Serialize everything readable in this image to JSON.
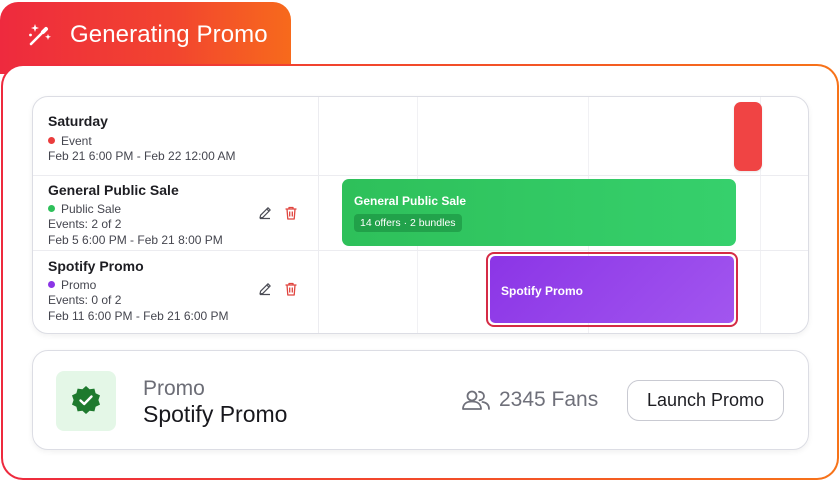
{
  "header": {
    "title": "Generating Promo",
    "icon": "magic-wand-icon"
  },
  "colors": {
    "accent_start": "#ee2a3e",
    "accent_end": "#f77319",
    "event": "#f04444",
    "public_sale": "#2ec05a",
    "promo": "#8b35e6",
    "verified": "#1e7a2e"
  },
  "schedule": {
    "rows": [
      {
        "title": "Saturday",
        "type": "Event",
        "dates": "Feb 21 6:00 PM - Feb 22 12:00 AM"
      },
      {
        "title": "General Public Sale",
        "type": "Public Sale",
        "events": "Events: 2 of 2",
        "dates": "Feb 5 6:00 PM - Feb 21 8:00 PM"
      },
      {
        "title": "Spotify Promo",
        "type": "Promo",
        "events": "Events: 0 of 2",
        "dates": "Feb 11 6:00 PM - Feb 21 6:00 PM"
      }
    ],
    "bars": {
      "public_sale": {
        "title": "General Public Sale",
        "badge": "14 offers · 2 bundles"
      },
      "promo": {
        "title": "Spotify Promo"
      }
    }
  },
  "summary": {
    "type_label": "Promo",
    "name": "Spotify Promo",
    "fans": "2345 Fans",
    "launch_label": "Launch Promo"
  }
}
